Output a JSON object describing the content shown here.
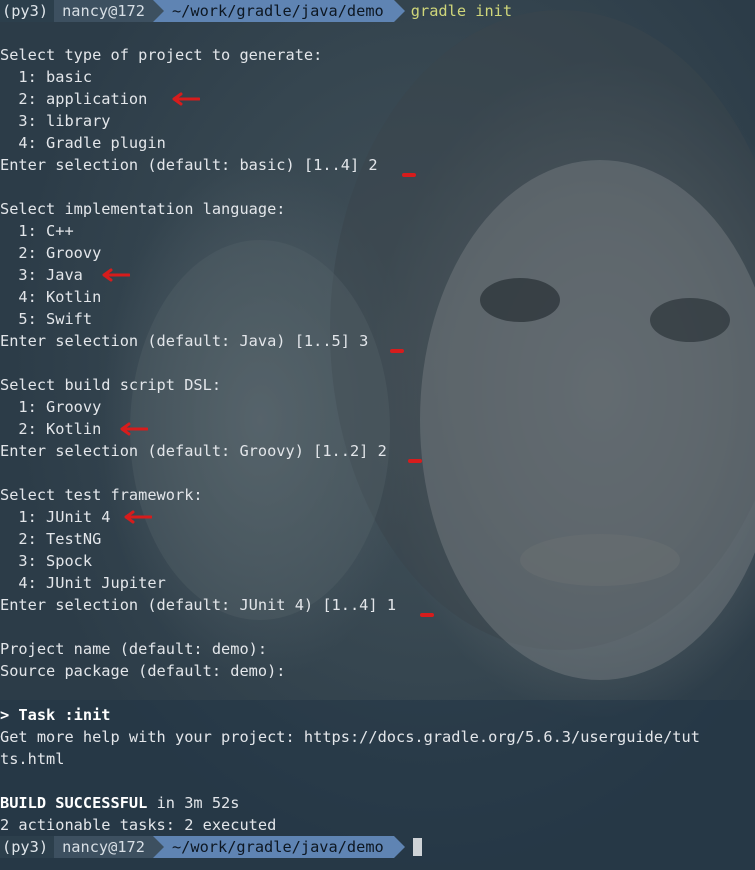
{
  "prompt": {
    "venv": "(py3)",
    "host": "nancy@172",
    "path": "~/work/gradle/java/demo",
    "command": "gradle init"
  },
  "project_type": {
    "header": "Select type of project to generate:",
    "options": [
      "1: basic",
      "2: application",
      "3: library",
      "4: Gradle plugin"
    ],
    "enter": "Enter selection (default: basic) [1..4] ",
    "answer": "2"
  },
  "language": {
    "header": "Select implementation language:",
    "options": [
      "1: C++",
      "2: Groovy",
      "3: Java",
      "4: Kotlin",
      "5: Swift"
    ],
    "enter": "Enter selection (default: Java) [1..5] ",
    "answer": "3"
  },
  "dsl": {
    "header": "Select build script DSL:",
    "options": [
      "1: Groovy",
      "2: Kotlin"
    ],
    "enter": "Enter selection (default: Groovy) [1..2] ",
    "answer": "2"
  },
  "test_framework": {
    "header": "Select test framework:",
    "options": [
      "1: JUnit 4",
      "2: TestNG",
      "3: Spock",
      "4: JUnit Jupiter"
    ],
    "enter": "Enter selection (default: JUnit 4) [1..4] ",
    "answer": "1"
  },
  "project_name": "Project name (default: demo):",
  "source_package": "Source package (default: demo):",
  "task": "> Task :init",
  "help_line1": "Get more help with your project: https://docs.gradle.org/5.6.3/userguide/tut",
  "help_line2": "ts.html",
  "build_label": "BUILD SUCCESSFUL",
  "build_time": " in 3m 52s",
  "tasks_summary": "2 actionable tasks: 2 executed",
  "colors": {
    "annotation": "#d71c1c",
    "command": "#cfd67a",
    "path_segment": "#5f84b3"
  }
}
